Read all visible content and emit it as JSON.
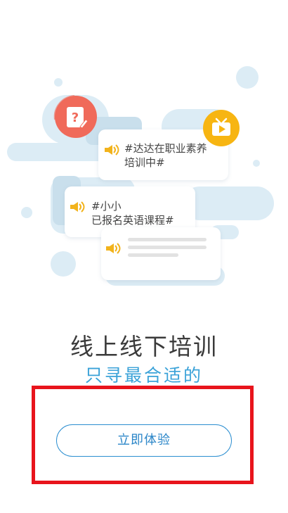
{
  "illustration": {
    "card_top": {
      "line1": "#达达在职业素养",
      "line2": "培训中#"
    },
    "card_middle": {
      "line1": "#小小",
      "line2": "已报名英语课程#"
    },
    "badge_question_icon": "question-note-icon",
    "badge_tv_icon": "tv-play-icon",
    "speaker_icon": "speaker-icon"
  },
  "headline": "线上线下培训",
  "subline": "只寻最合适的",
  "cta": {
    "label": "立即体验"
  },
  "colors": {
    "accent_blue": "#3aa2d8",
    "button_border": "#2b8ed0",
    "highlight_frame": "#e8141c",
    "badge_red": "#f06a5a",
    "badge_yellow": "#f7b512",
    "speaker_yellow": "#f2b31c",
    "bg_light_blue": "#dcecf5"
  }
}
